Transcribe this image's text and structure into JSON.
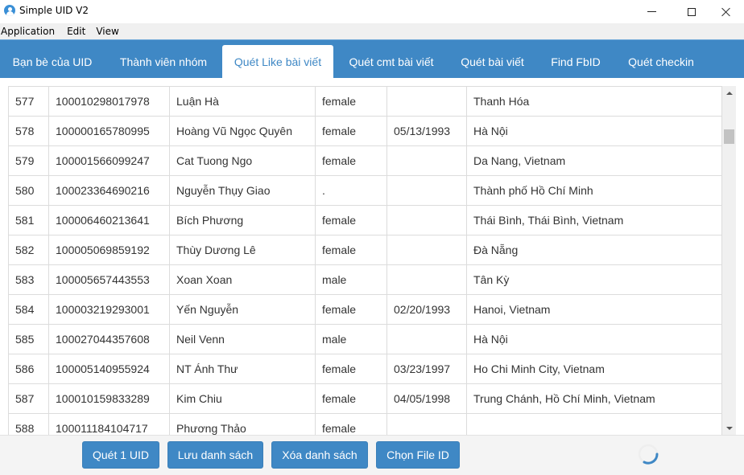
{
  "window": {
    "title": "Simple UID V2",
    "controls": {
      "minimize": "minimize",
      "maximize": "maximize",
      "close": "close"
    }
  },
  "menu": {
    "items": [
      {
        "label": "Application"
      },
      {
        "label": "Edit"
      },
      {
        "label": "View"
      }
    ]
  },
  "tabs": [
    {
      "label": "Bạn bè của UID",
      "active": false
    },
    {
      "label": "Thành viên nhóm",
      "active": false
    },
    {
      "label": "Quét Like bài viết",
      "active": true
    },
    {
      "label": "Quét cmt bài viết",
      "active": false
    },
    {
      "label": "Quét bài viết",
      "active": false
    },
    {
      "label": "Find FbID",
      "active": false
    },
    {
      "label": "Quét checkin",
      "active": false
    }
  ],
  "table": {
    "rows": [
      {
        "index": "577",
        "uid": "100010298017978",
        "name": "Luận Hà",
        "gender": "female",
        "birthday": "",
        "location": "Thanh Hóa"
      },
      {
        "index": "578",
        "uid": "100000165780995",
        "name": "Hoàng Vũ Ngọc Quyên",
        "gender": "female",
        "birthday": "05/13/1993",
        "location": "Hà Nội"
      },
      {
        "index": "579",
        "uid": "100001566099247",
        "name": "Cat Tuong Ngo",
        "gender": "female",
        "birthday": "",
        "location": "Da Nang, Vietnam"
      },
      {
        "index": "580",
        "uid": "100023364690216",
        "name": "Nguyễn Thụy Giao",
        "gender": ".",
        "birthday": "",
        "location": "Thành phố Hồ Chí Minh"
      },
      {
        "index": "581",
        "uid": "100006460213641",
        "name": "Bích Phương",
        "gender": "female",
        "birthday": "",
        "location": "Thái Bình, Thái Bình, Vietnam"
      },
      {
        "index": "582",
        "uid": "100005069859192",
        "name": "Thùy Dương Lê",
        "gender": "female",
        "birthday": "",
        "location": "Đà Nẵng"
      },
      {
        "index": "583",
        "uid": "100005657443553",
        "name": "Xoan Xoan",
        "gender": "male",
        "birthday": "",
        "location": "Tân Kỳ"
      },
      {
        "index": "584",
        "uid": "100003219293001",
        "name": "Yến Nguyễn",
        "gender": "female",
        "birthday": "02/20/1993",
        "location": "Hanoi, Vietnam"
      },
      {
        "index": "585",
        "uid": "100027044357608",
        "name": "Neil Venn",
        "gender": "male",
        "birthday": "",
        "location": "Hà Nội"
      },
      {
        "index": "586",
        "uid": "100005140955924",
        "name": "NT Ánh Thư",
        "gender": "female",
        "birthday": "03/23/1997",
        "location": "Ho Chi Minh City, Vietnam"
      },
      {
        "index": "587",
        "uid": "100010159833289",
        "name": "Kim Chiu",
        "gender": "female",
        "birthday": "04/05/1998",
        "location": "Trung Chánh, Hồ Chí Minh, Vietnam"
      },
      {
        "index": "588",
        "uid": "100011184104717",
        "name": "Phương Thảo",
        "gender": "female",
        "birthday": "",
        "location": ""
      }
    ]
  },
  "buttons": {
    "scan_one": "Quét 1 UID",
    "save_list": "Lưu danh sách",
    "clear_list": "Xóa danh sách",
    "choose_file": "Chọn File ID"
  },
  "status": {
    "loading": true
  },
  "colors": {
    "accent": "#3f88c5",
    "tab_active_text": "#3f88c5",
    "border": "#dcdcdc"
  }
}
